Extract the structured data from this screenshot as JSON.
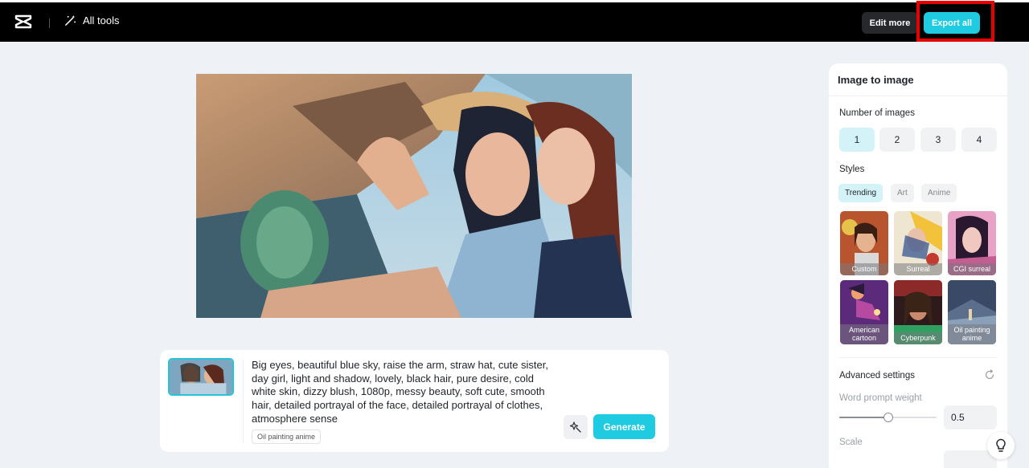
{
  "header": {
    "logo_icon": "capcut-logo-icon",
    "all_tools_label": "All tools",
    "edit_more_label": "Edit more",
    "export_all_label": "Export all",
    "accent_color": "#1ecbe1",
    "highlight_color": "#e60000"
  },
  "prompt": {
    "text": "Big eyes, beautiful blue sky, raise the arm, straw hat, cute sister, day girl, light and shadow, lovely, black hair, pure desire, cold white skin, dizzy blush, 1080p, messy beauty, soft cute, smooth hair, detailed portrayal of the face, detailed portrayal of clothes, atmosphere sense",
    "style_chip": "Oil painting anime",
    "generate_label": "Generate"
  },
  "panel": {
    "title": "Image to image",
    "number_label": "Number of images",
    "numbers": [
      "1",
      "2",
      "3",
      "4"
    ],
    "selected_number": "1",
    "styles_label": "Styles",
    "style_tabs": [
      "Trending",
      "Art",
      "Anime"
    ],
    "active_tab": "Trending",
    "style_tiles": [
      {
        "label": "Custom"
      },
      {
        "label": "Surreal"
      },
      {
        "label": "CGI surreal"
      },
      {
        "label": "American cartoon"
      },
      {
        "label": "Cyberpunk"
      },
      {
        "label": "Oil painting anime"
      }
    ],
    "selected_style": "Oil painting anime",
    "advanced_label": "Advanced settings",
    "word_prompt_weight_label": "Word prompt weight",
    "word_prompt_weight_value": "0.5",
    "scale_label": "Scale"
  }
}
